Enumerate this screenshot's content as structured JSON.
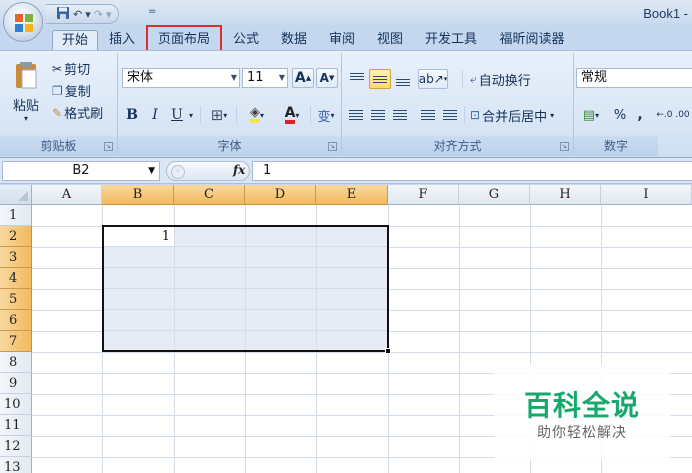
{
  "window": {
    "title": "Book1 -"
  },
  "quick_access": {
    "undo": "↶",
    "redo": "↷",
    "more": "="
  },
  "tabs": [
    {
      "label": "开始"
    },
    {
      "label": "插入"
    },
    {
      "label": "页面布局"
    },
    {
      "label": "公式"
    },
    {
      "label": "数据"
    },
    {
      "label": "审阅"
    },
    {
      "label": "视图"
    },
    {
      "label": "开发工具"
    },
    {
      "label": "福昕阅读器"
    }
  ],
  "ribbon": {
    "clipboard": {
      "paste": "粘贴",
      "cut": "剪切",
      "copy": "复制",
      "format_painter": "格式刷",
      "label": "剪贴板"
    },
    "font": {
      "name": "宋体",
      "size": "11",
      "label": "字体",
      "bold": "B",
      "italic": "I",
      "underline": "U",
      "grow": "A",
      "shrink": "A",
      "phonetic": "变"
    },
    "alignment": {
      "wrap": "自动换行",
      "merge": "合并后居中",
      "label": "对齐方式"
    },
    "number": {
      "format": "常规",
      "percent": "%",
      "comma": ",",
      "label": "数字"
    }
  },
  "formula_bar": {
    "name_box": "B2",
    "fx": "fx",
    "value": "1"
  },
  "sheet": {
    "columns": [
      "A",
      "B",
      "C",
      "D",
      "E",
      "F",
      "G",
      "H",
      "I"
    ],
    "rows": [
      "1",
      "2",
      "3",
      "4",
      "5",
      "6",
      "7",
      "8",
      "9",
      "10",
      "11",
      "12",
      "13"
    ],
    "selected_range": "B2:E7",
    "active_cell": {
      "ref": "B2",
      "value": "1"
    }
  },
  "watermark": {
    "title": "百科全说",
    "subtitle": "助你轻松解决"
  },
  "colors": {
    "highlight_box": "#d9302c",
    "selection_fill": "#e5eaf5",
    "header_highlight": "#f1b95e",
    "watermark": "#17a86b"
  }
}
